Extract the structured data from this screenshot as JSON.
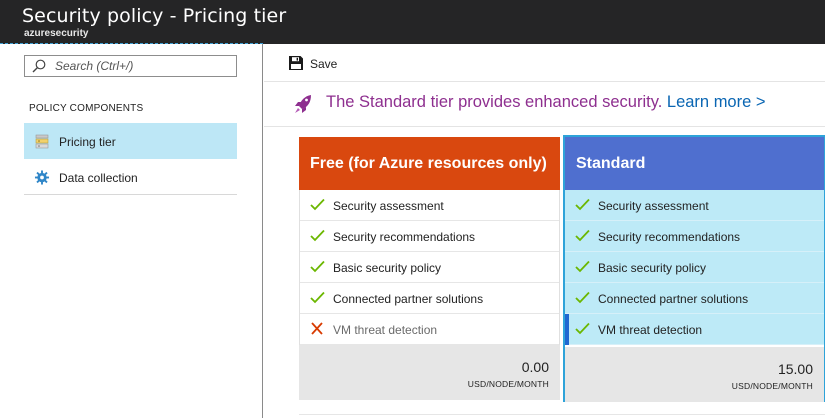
{
  "window": {
    "title": "Security policy - Pricing tier",
    "subtitle": "azuresecurity"
  },
  "sidebar": {
    "search_placeholder": "Search (Ctrl+/)",
    "section_heading": "POLICY COMPONENTS",
    "items": [
      {
        "label": "Pricing tier",
        "icon": "pricing-tier-icon",
        "active": true
      },
      {
        "label": "Data collection",
        "icon": "gear-icon",
        "active": false
      }
    ]
  },
  "toolbar": {
    "save_label": "Save"
  },
  "banner": {
    "text": "The Standard tier provides enhanced security.",
    "link": "Learn more >"
  },
  "tiers": {
    "free": {
      "name": "Free (for Azure resources only)",
      "features": [
        {
          "label": "Security assessment",
          "included": true
        },
        {
          "label": "Security recommendations",
          "included": true
        },
        {
          "label": "Basic security policy",
          "included": true
        },
        {
          "label": "Connected partner solutions",
          "included": true
        },
        {
          "label": "VM threat detection",
          "included": false
        }
      ],
      "price": "0.00",
      "unit": "USD/NODE/MONTH"
    },
    "standard": {
      "name": "Standard",
      "selected": true,
      "features": [
        {
          "label": "Security assessment",
          "included": true
        },
        {
          "label": "Security recommendations",
          "included": true
        },
        {
          "label": "Basic security policy",
          "included": true
        },
        {
          "label": "Connected partner solutions",
          "included": true
        },
        {
          "label": "VM threat detection",
          "included": true
        }
      ],
      "price": "15.00",
      "unit": "USD/NODE/MONTH"
    }
  },
  "colors": {
    "title_bar": "#252526",
    "free_header": "#d9480f",
    "standard_header": "#4f6fcf",
    "selected_bg": "#bdeaf7",
    "banner_text": "#8e2f8f",
    "link": "#0a66b3",
    "check": "#6bb700",
    "cross": "#d83b01"
  }
}
